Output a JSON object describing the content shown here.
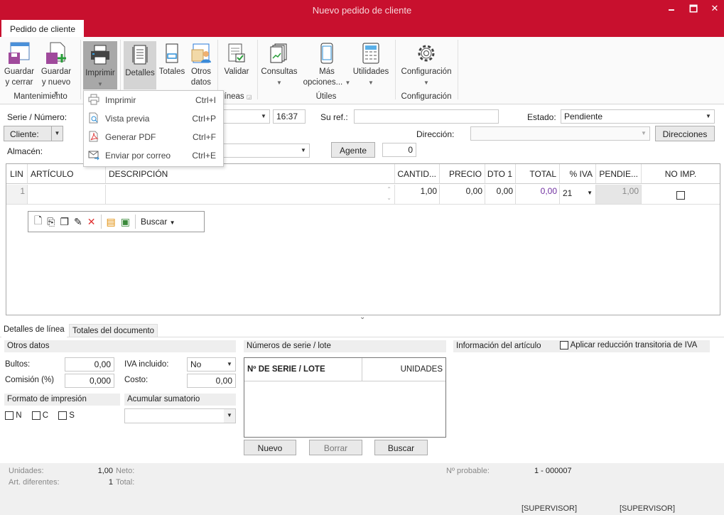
{
  "window": {
    "title": "Nuevo pedido de cliente",
    "minimize": "🗕",
    "maximize": "🗖",
    "close": "✕"
  },
  "ribbon": {
    "tab": "Pedido de cliente",
    "buttons": [
      {
        "label1": "Guardar",
        "label2": "y cerrar"
      },
      {
        "label1": "Guardar",
        "label2": "y nuevo"
      },
      {
        "label1": "Imprimir"
      },
      {
        "label1": "Detalles"
      },
      {
        "label1": "Totales"
      },
      {
        "label1": "Otros",
        "label2": "datos"
      },
      {
        "label1": "Validar"
      },
      {
        "label1": "Consultas"
      },
      {
        "label1": "Más",
        "label2": "opciones..."
      },
      {
        "label1": "Utilidades"
      },
      {
        "label1": "Configuración"
      }
    ],
    "groups": {
      "mantenimiento": "Mantenimiento",
      "lineas": "íneas",
      "utiles": "Útiles",
      "configuracion": "Configuración"
    }
  },
  "print_menu": [
    {
      "label": "Imprimir",
      "shortcut": "Ctrl+I"
    },
    {
      "label": "Vista previa",
      "shortcut": "Ctrl+P"
    },
    {
      "label": "Generar PDF",
      "shortcut": "Ctrl+F"
    },
    {
      "label": "Enviar por correo",
      "shortcut": "Ctrl+E"
    }
  ],
  "header": {
    "serie_label": "Serie / Número:",
    "time": "16:37",
    "suref_label": "Su ref.:",
    "suref_value": "",
    "estado_label": "Estado:",
    "estado_value": "Pendiente",
    "cliente_label": "Cliente:",
    "direccion_label": "Dirección:",
    "direcciones_button": "Direcciones",
    "almacen_label": "Almacén:",
    "agente_button": "Agente",
    "agente_value": "0"
  },
  "grid": {
    "columns": [
      "LIN",
      "ARTÍCULO",
      "DESCRIPCIÓN",
      "CANTID...",
      "PRECIO",
      "DTO 1",
      "TOTAL",
      "% IVA",
      "PENDIE...",
      "NO IMP."
    ],
    "rows": [
      {
        "lin": "1",
        "articulo": "",
        "descripcion": "",
        "cantidad": "1,00",
        "precio": "0,00",
        "dto1": "0,00",
        "total": "0,00",
        "iva": "21",
        "pendiente": "1,00",
        "noimp": false
      }
    ],
    "toolbar_search": "Buscar"
  },
  "bottom_tabs": [
    "Detalles de línea",
    "Totales del documento"
  ],
  "otros_datos": {
    "title": "Otros datos",
    "bultos_label": "Bultos:",
    "bultos": "0,00",
    "comision_label": "Comisión (%)",
    "comision": "0,000",
    "iva_label": "IVA incluido:",
    "iva": "No",
    "costo_label": "Costo:",
    "costo": "0,00"
  },
  "formato": {
    "title": "Formato de impresión",
    "options": [
      "N",
      "C",
      "S"
    ]
  },
  "acumular": {
    "title": "Acumular sumatorio",
    "value": ""
  },
  "serie_lote": {
    "title": "Números de serie / lote",
    "col1": "Nº DE SERIE / LOTE",
    "col2": "UNIDADES",
    "nuevo": "Nuevo",
    "borrar": "Borrar",
    "buscar": "Buscar"
  },
  "info": {
    "title": "Información del artículo",
    "aplicar": "Aplicar reducción transitoria de IVA"
  },
  "footer": {
    "unidades_label": "Unidades:",
    "unidades": "1,00",
    "neto_label": "Neto:",
    "art_label": "Art. diferentes:",
    "art": "1",
    "total_label": "Total:",
    "probable_label": "Nº probable:",
    "probable": "1 - 000007",
    "user1": "[SUPERVISOR]",
    "user2": "[SUPERVISOR]"
  },
  "colors": {
    "accent": "#c8102e"
  }
}
